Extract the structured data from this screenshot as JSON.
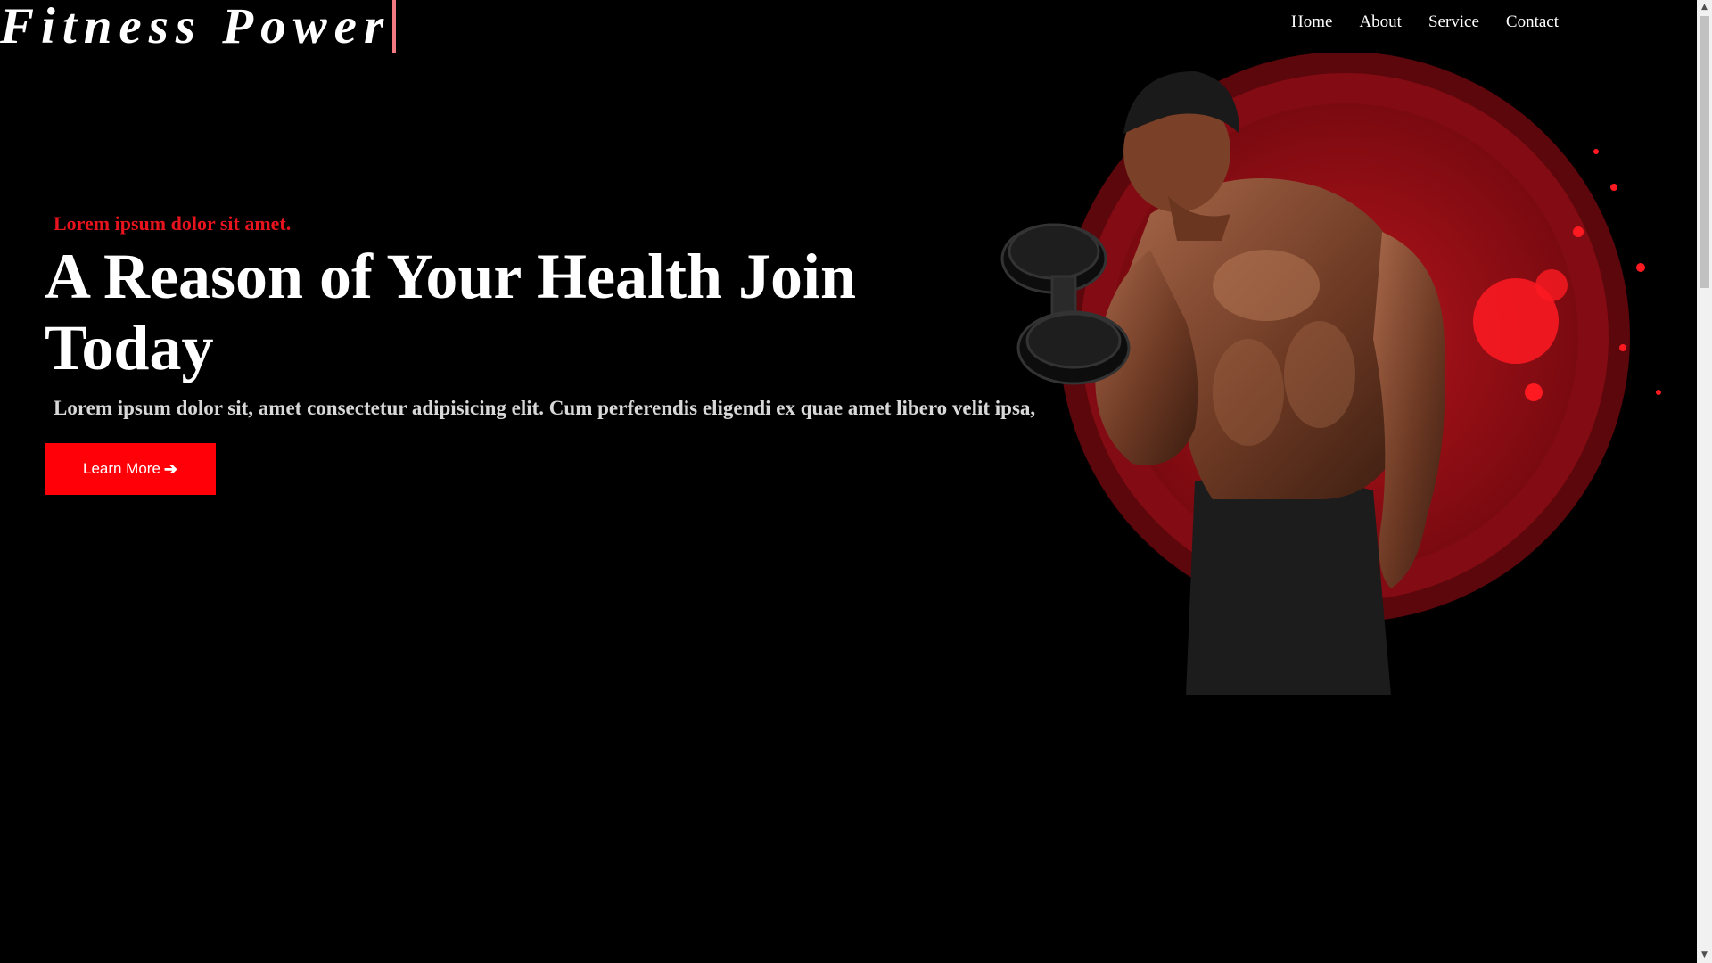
{
  "brand": {
    "name": "Fitness Power"
  },
  "nav": {
    "items": [
      {
        "label": "Home"
      },
      {
        "label": "About"
      },
      {
        "label": "Service"
      },
      {
        "label": "Contact"
      }
    ]
  },
  "hero": {
    "kicker": "Lorem ipsum dolor sit amet.",
    "title": "A Reason of Your Health Join Today",
    "description": "Lorem ipsum dolor sit, amet consectetur adipisicing elit. Cum perferendis eligendi ex quae amet libero velit ipsa,",
    "cta_label": "Learn More",
    "cta_icon": "arrow-right-icon",
    "image": "bodybuilder-with-dumbbell-on-red-circle"
  },
  "colors": {
    "accent": "#ff0008",
    "kicker": "#e8141d",
    "background": "#000000",
    "brand_cursor": "#f07a80"
  }
}
